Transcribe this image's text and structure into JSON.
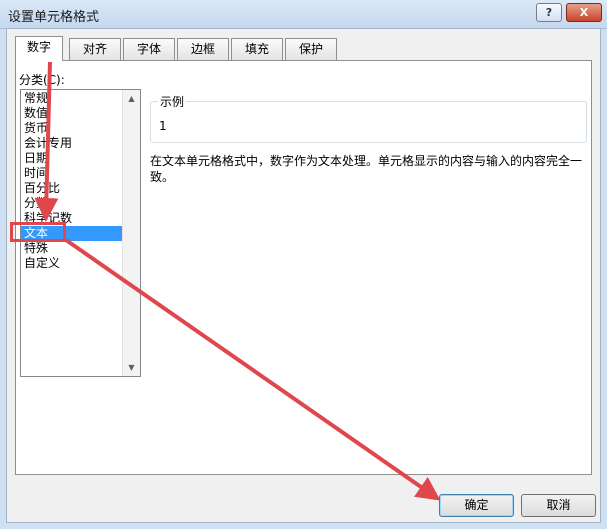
{
  "window": {
    "title": "设置单元格格式",
    "help_button": "?",
    "close_button": "X"
  },
  "tabs": [
    {
      "label": "数字",
      "active": true
    },
    {
      "label": "对齐",
      "active": false
    },
    {
      "label": "字体",
      "active": false
    },
    {
      "label": "边框",
      "active": false
    },
    {
      "label": "填充",
      "active": false
    },
    {
      "label": "保护",
      "active": false
    }
  ],
  "category": {
    "label": "分类(C):",
    "items": [
      "常规",
      "数值",
      "货币",
      "会计专用",
      "日期",
      "时间",
      "百分比",
      "分数",
      "科学记数",
      "文本",
      "特殊",
      "自定义"
    ],
    "selected": "文本"
  },
  "sample": {
    "legend": "示例",
    "value": "1"
  },
  "description": "在文本单元格格式中，数字作为文本处理。单元格显示的内容与输入的内容完全一致。",
  "buttons": {
    "ok": "确定",
    "cancel": "取消"
  },
  "colors": {
    "annotation_red": "#e0474c",
    "selection_blue": "#3399ff"
  }
}
